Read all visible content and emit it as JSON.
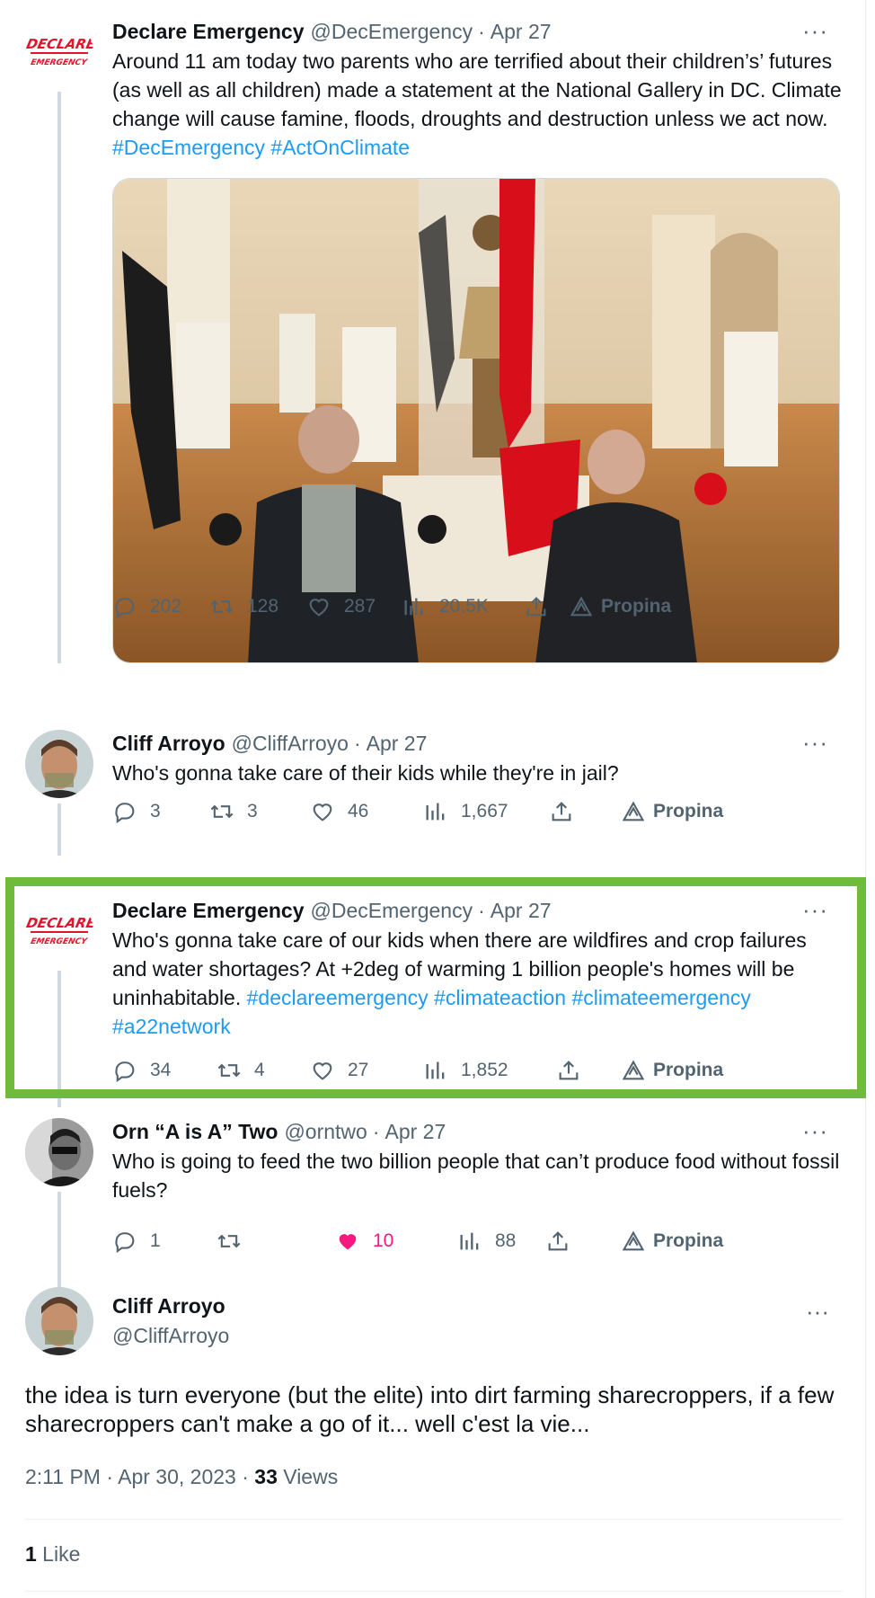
{
  "thread": [
    {
      "name": "Declare Emergency",
      "handle": "@DecEmergency",
      "date": "Apr 27",
      "text_parts": [
        "Around 11 am today two parents who are terrified about their children’s’ futures (as well as all children) made a statement at the National Gallery in DC.  Climate change will cause famine, floods, droughts and destruction unless we act now. ",
        "#DecEmergency",
        " ",
        "#ActOnClimate"
      ],
      "stats": {
        "replies": "202",
        "retweets": "128",
        "likes": "287",
        "views": "20.5K",
        "promote": "Propina"
      },
      "logo_text": [
        "DECLARE",
        "EMERGENCY"
      ]
    },
    {
      "name": "Cliff Arroyo",
      "handle": "@CliffArroyo",
      "date": "Apr 27",
      "text": "Who's gonna take care of their kids while they're in jail?",
      "stats": {
        "replies": "3",
        "retweets": "3",
        "likes": "46",
        "views": "1,667",
        "promote": "Propina"
      }
    },
    {
      "name": "Declare Emergency",
      "handle": "@DecEmergency",
      "date": "Apr 27",
      "text_parts": [
        "Who's gonna take care of our kids when there are wildfires and crop failures and water shortages? At +2deg of warming 1 billion people's homes will be uninhabitable. ",
        "#declareemergency",
        " ",
        "#climateaction",
        " ",
        "#climateemergency",
        " ",
        "#a22network"
      ],
      "stats": {
        "replies": "34",
        "retweets": "4",
        "likes": "27",
        "views": "1,852",
        "promote": "Propina"
      },
      "logo_text": [
        "DECLARE",
        "EMERGENCY"
      ]
    },
    {
      "name": "Orn “A is A” Two",
      "handle": "@orntwo",
      "date": "Apr 27",
      "text": "Who is going to feed the two billion people that can’t produce food without fossil fuels?",
      "stats": {
        "replies": "1",
        "retweets": "",
        "likes": "10",
        "views": "88",
        "promote": "Propina"
      }
    }
  ],
  "main": {
    "name": "Cliff Arroyo",
    "handle": "@CliffArroyo",
    "text": "the idea is turn everyone (but the elite) into dirt farming sharecroppers, if a few sharecroppers can't make a go of it... well c'est la vie...",
    "time": "2:11 PM · Apr 30, 2023 · ",
    "views_count": "33",
    "views_label": " Views",
    "likes_count": "1",
    "likes_label": " Like"
  },
  "more_glyph": "···",
  "dot": "·",
  "colors": {
    "accent": "#1d9bf0",
    "like": "#f91880",
    "highlight": "#6fbb3b",
    "logo": "#e0142a"
  }
}
